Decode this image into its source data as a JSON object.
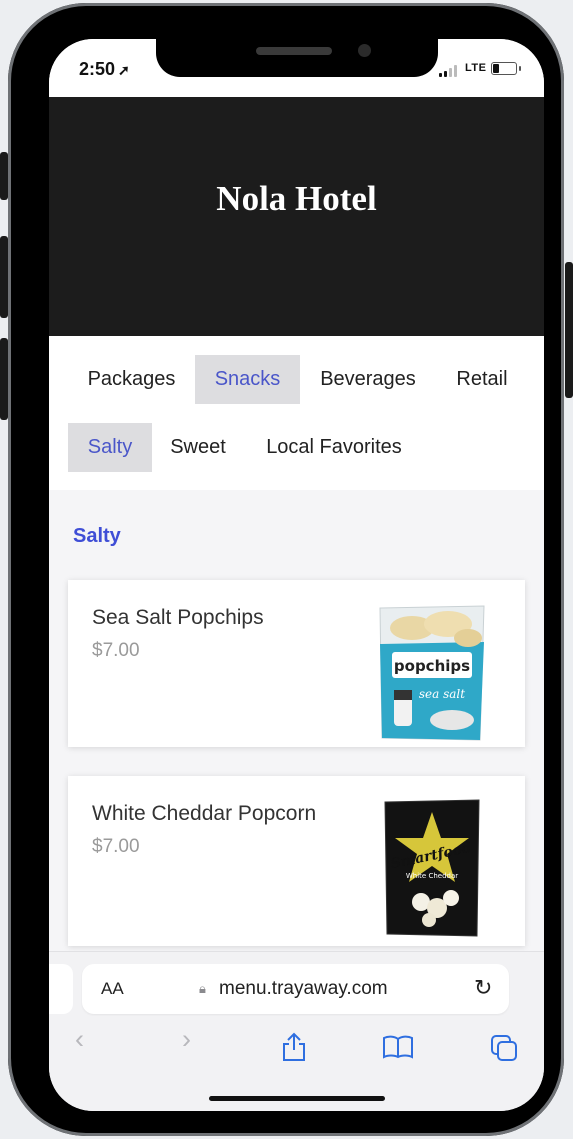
{
  "status_bar": {
    "time": "2:50",
    "location_icon": "location-arrow-icon",
    "network": "LTE"
  },
  "hero": {
    "title": "Nola Hotel"
  },
  "category_tabs": [
    {
      "label": "Packages",
      "active": false
    },
    {
      "label": "Snacks",
      "active": true
    },
    {
      "label": "Beverages",
      "active": false
    },
    {
      "label": "Retail",
      "active": false
    }
  ],
  "subcategory_tabs": [
    {
      "label": "Salty",
      "active": true
    },
    {
      "label": "Sweet",
      "active": false
    },
    {
      "label": "Local Favorites",
      "active": false
    }
  ],
  "section": {
    "title": "Salty"
  },
  "items": [
    {
      "name": "Sea Salt Popchips",
      "price": "$7.00",
      "image_brand": "popchips",
      "image_label": "sea salt"
    },
    {
      "name": "White Cheddar Popcorn",
      "price": "$7.00",
      "image_brand": "Smartfood",
      "image_label": "White Cheddar"
    }
  ],
  "browser": {
    "text_size_label": "AA",
    "url": "menu.trayaway.com",
    "icons": [
      "lock-icon",
      "reload-icon",
      "back-icon",
      "forward-icon",
      "share-icon",
      "bookmarks-icon",
      "tabs-icon"
    ]
  },
  "colors": {
    "accent": "#4a56c9",
    "section_title": "#3f4ed6",
    "hero_bg": "#1c1c1c",
    "active_tab_bg": "#dddde0",
    "browser_icon": "#2f6fe0"
  }
}
